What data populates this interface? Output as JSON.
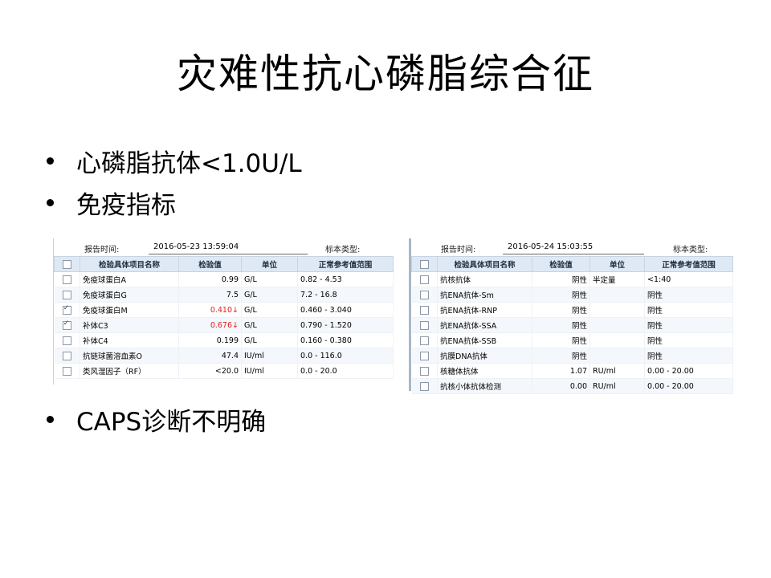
{
  "title": "灾难性抗心磷脂综合征",
  "bullets": [
    "心磷脂抗体<1.0U/L",
    "免疫指标",
    "CAPS诊断不明确"
  ],
  "table1": {
    "report_time_label": "报告时间:",
    "report_time": "2016-05-23 13:59:04",
    "specimen_label": "标本类型:",
    "headers": [
      "检验具体项目名称",
      "检验值",
      "单位",
      "正常参考值范围"
    ],
    "rows": [
      {
        "name": "免疫球蛋白A",
        "value": "0.99",
        "unit": "G/L",
        "range": "0.82 - 4.53",
        "checked": false,
        "flag": false
      },
      {
        "name": "免疫球蛋白G",
        "value": "7.5",
        "unit": "G/L",
        "range": "7.2 - 16.8",
        "checked": false,
        "flag": false
      },
      {
        "name": "免疫球蛋白M",
        "value": "0.410↓",
        "unit": "G/L",
        "range": "0.460 - 3.040",
        "checked": true,
        "flag": true
      },
      {
        "name": "补体C3",
        "value": "0.676↓",
        "unit": "G/L",
        "range": "0.790 - 1.520",
        "checked": true,
        "flag": true
      },
      {
        "name": "补体C4",
        "value": "0.199",
        "unit": "G/L",
        "range": "0.160 - 0.380",
        "checked": false,
        "flag": false
      },
      {
        "name": "抗链球菌溶血素O",
        "value": "47.4",
        "unit": "IU/ml",
        "range": "0.0 - 116.0",
        "checked": false,
        "flag": false
      },
      {
        "name": "类风湿因子（RF）",
        "value": "<20.0",
        "unit": "IU/ml",
        "range": "0.0 - 20.0",
        "checked": false,
        "flag": false
      }
    ]
  },
  "table2": {
    "report_time_label": "报告时间:",
    "report_time": "2016-05-24 15:03:55",
    "specimen_label": "标本类型:",
    "headers": [
      "检验具体项目名称",
      "检验值",
      "单位",
      "正常参考值范围"
    ],
    "rows": [
      {
        "name": "抗核抗体",
        "value": "阴性",
        "unit": "半定量",
        "range": "<1:40"
      },
      {
        "name": "抗ENA抗体-Sm",
        "value": "阴性",
        "unit": "",
        "range": "阴性"
      },
      {
        "name": "抗ENA抗体-RNP",
        "value": "阴性",
        "unit": "",
        "range": "阴性"
      },
      {
        "name": "抗ENA抗体-SSA",
        "value": "阴性",
        "unit": "",
        "range": "阴性"
      },
      {
        "name": "抗ENA抗体-SSB",
        "value": "阴性",
        "unit": "",
        "range": "阴性"
      },
      {
        "name": "抗膜DNA抗体",
        "value": "阴性",
        "unit": "",
        "range": "阴性"
      },
      {
        "name": "核糖体抗体",
        "value": "1.07",
        "unit": "RU/ml",
        "range": "0.00 - 20.00"
      },
      {
        "name": "抗核小体抗体检测",
        "value": "0.00",
        "unit": "RU/ml",
        "range": "0.00 - 20.00"
      }
    ]
  }
}
